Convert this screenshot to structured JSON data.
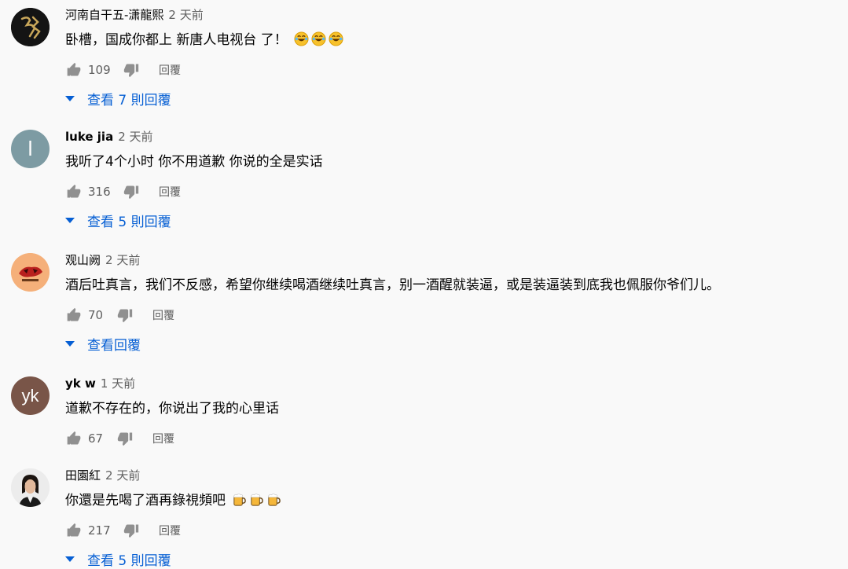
{
  "icons": {
    "like": "thumb-up-icon",
    "dislike": "thumb-down-icon",
    "expand": "caret-down-icon"
  },
  "colors": {
    "link": "#065fd4",
    "secondary": "#606060",
    "background": "#f9f9f9"
  },
  "reply_label": "回覆",
  "comments": [
    {
      "author": "河南自干五-潇龍熙",
      "time": "2 天前",
      "text": "卧槽，国成你都上 新唐人电视台 了！",
      "emojis": [
        "grinning-tears-emoji",
        "grinning-tears-emoji",
        "grinning-tears-emoji"
      ],
      "likes": "109",
      "replies_label": "查看 7 則回覆"
    },
    {
      "author": "luke jia",
      "time": "2 天前",
      "text": "我听了4个小时 你不用道歉 你说的全是实话",
      "likes": "316",
      "replies_label": "查看 5 則回覆",
      "avatar_letter": "l"
    },
    {
      "author": "观山阙",
      "time": "2 天前",
      "text": "酒后吐真言，我们不反感，希望你继续喝酒继续吐真言，别一酒醒就装逼，或是装逼装到底我也佩服你爷们儿。",
      "likes": "70",
      "replies_label": "查看回覆"
    },
    {
      "author": "yk w",
      "time": "1 天前",
      "text": "道歉不存在的，你说出了我的心里话",
      "likes": "67",
      "avatar_letter": "yk"
    },
    {
      "author": "田園紅",
      "time": "2 天前",
      "text": "你還是先喝了酒再錄視頻吧",
      "emojis": [
        "beer-mug-emoji",
        "beer-mug-emoji",
        "beer-mug-emoji"
      ],
      "likes": "217",
      "replies_label": "查看 5 則回覆"
    }
  ]
}
